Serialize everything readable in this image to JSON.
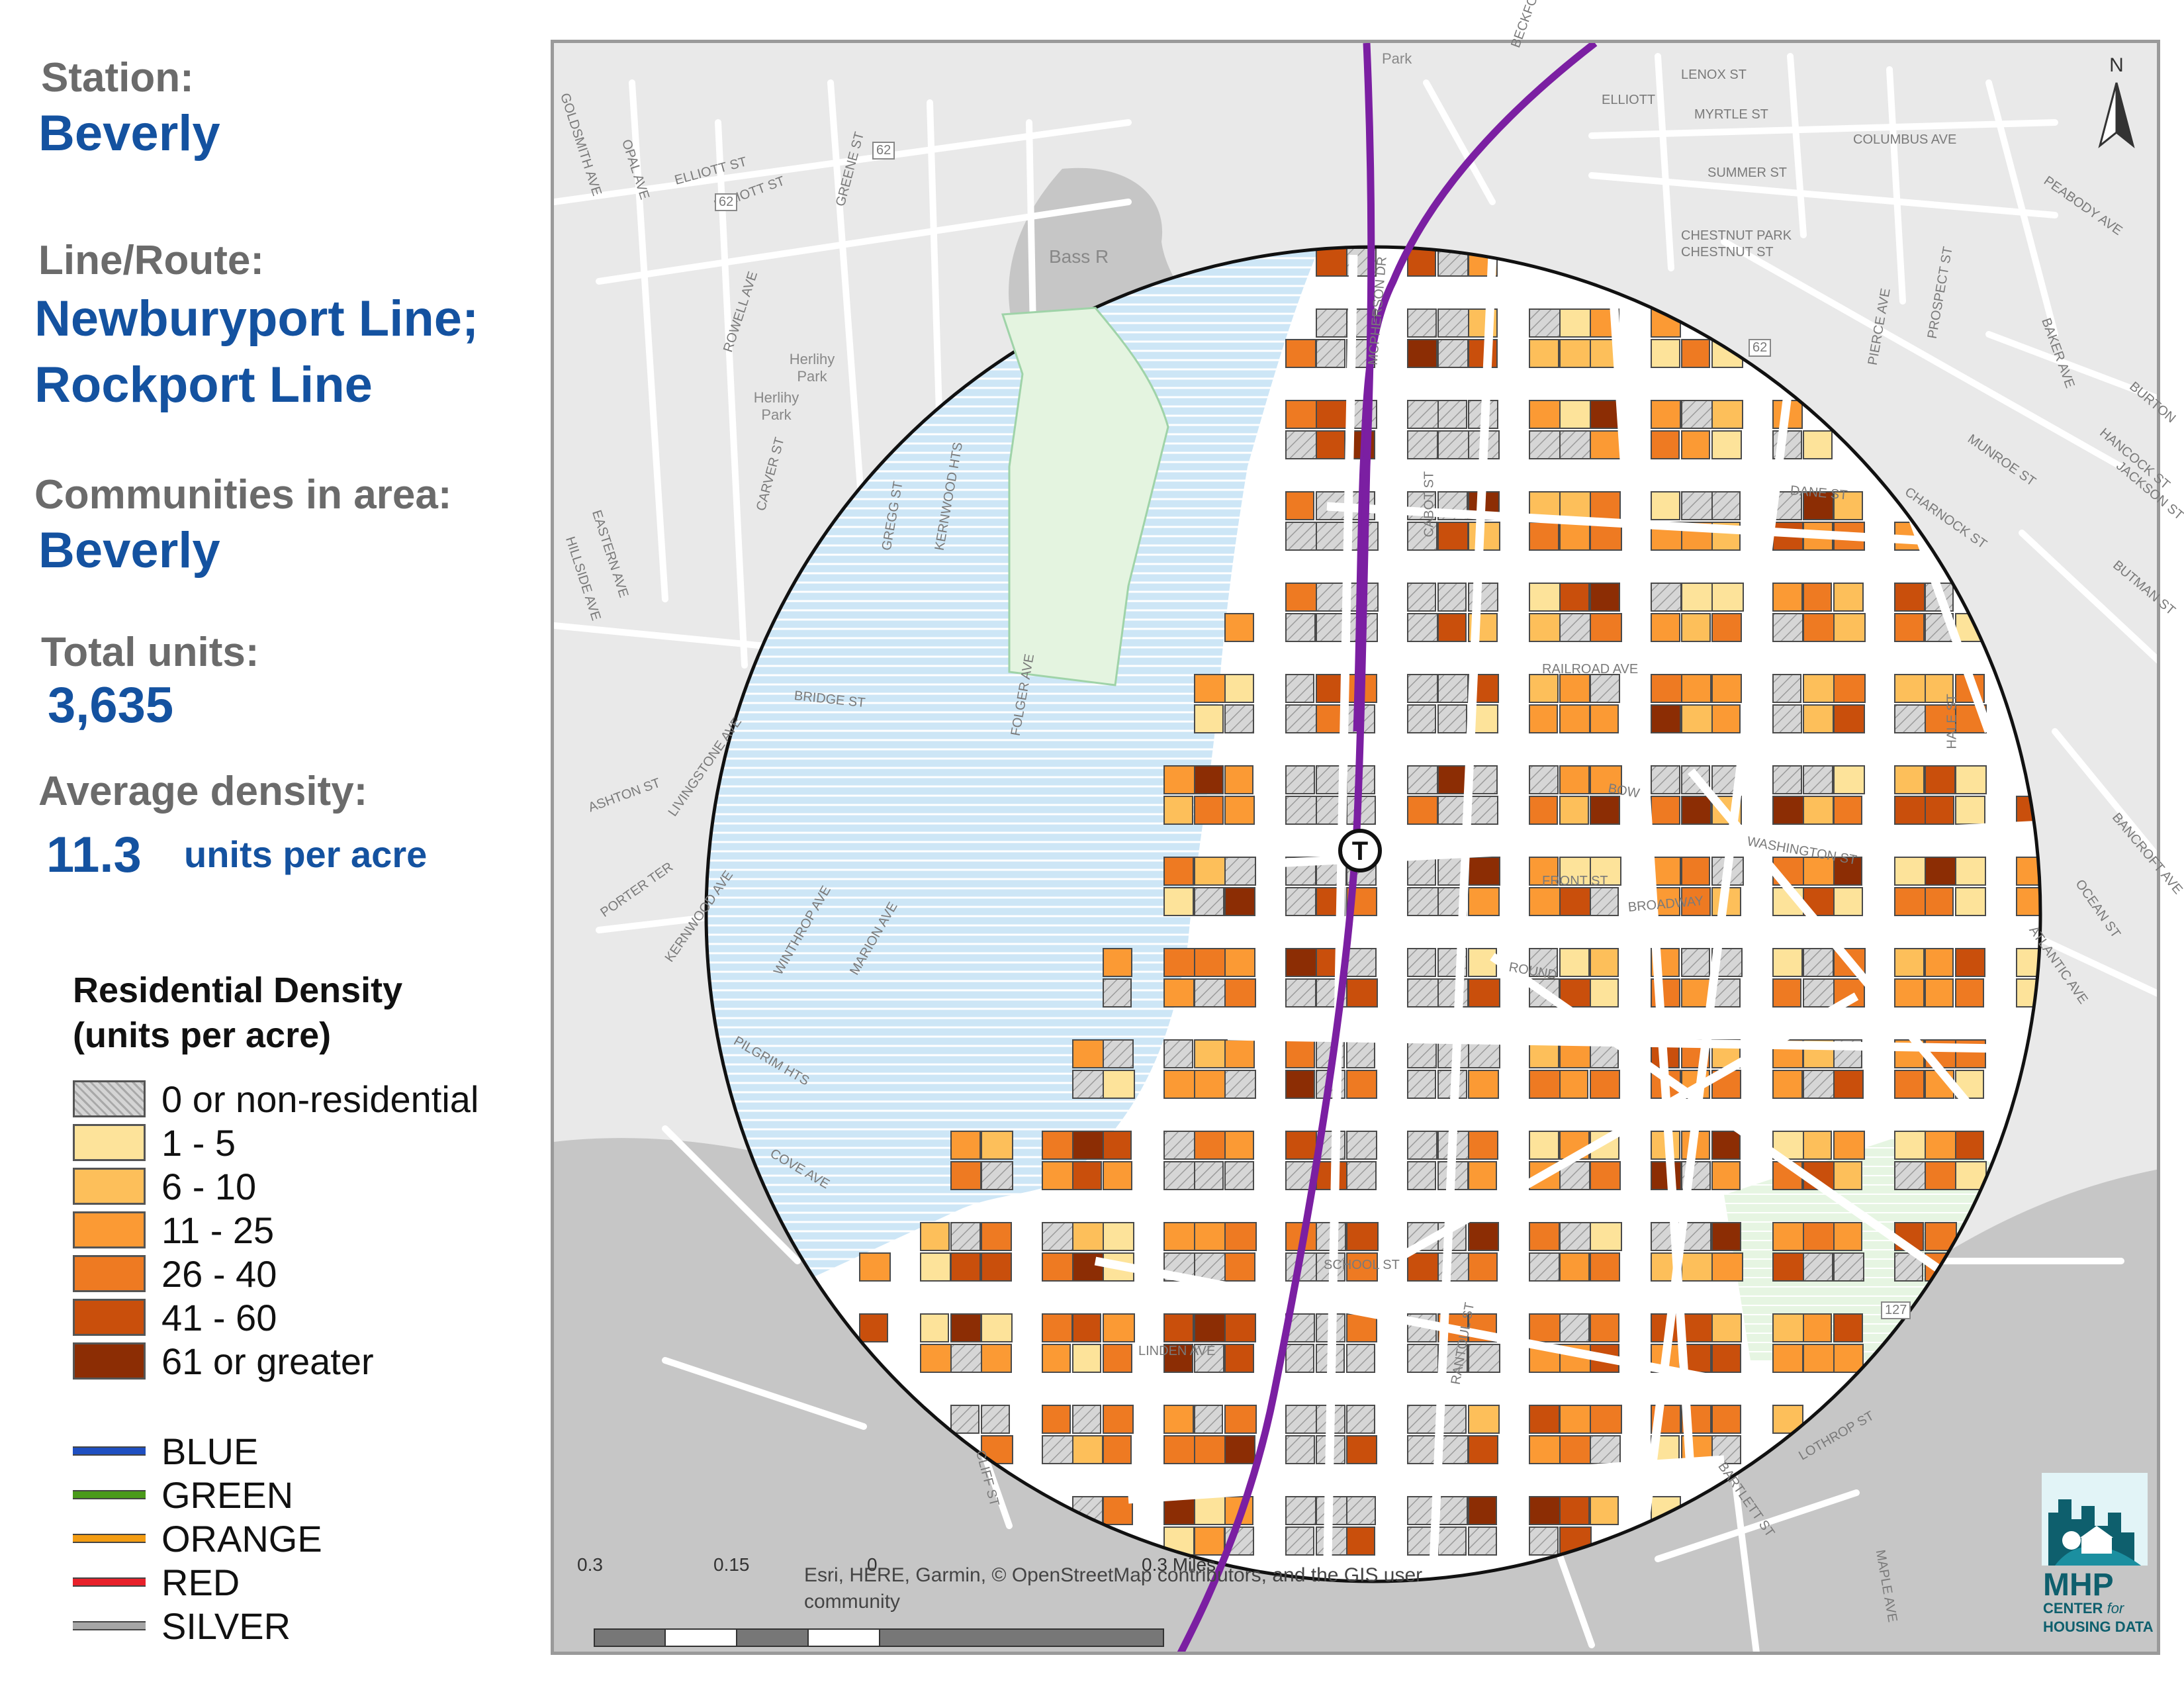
{
  "info": {
    "station_label": "Station:",
    "station_value": "Beverly",
    "line_label": "Line/Route:",
    "line_value_1": "Newburyport Line;",
    "line_value_2": "Rockport Line",
    "communities_label": "Communities in area:",
    "communities_value": "Beverly",
    "total_units_label": "Total units:",
    "total_units_value": "3,635",
    "avg_density_label": "Average density:",
    "avg_density_value": "11.3",
    "avg_density_unit": "units per acre"
  },
  "legend": {
    "title_1": "Residential Density",
    "title_2": "(units per acre)",
    "density_classes": [
      {
        "label": "0 or non-residential",
        "color": "#d4d4d4",
        "hatched": true
      },
      {
        "label": "1 - 5",
        "color": "#fde39a"
      },
      {
        "label": "6 - 10",
        "color": "#fdbf5a"
      },
      {
        "label": "11 - 25",
        "color": "#fb9a34"
      },
      {
        "label": "26 - 40",
        "color": "#ee7a22"
      },
      {
        "label": "41 - 60",
        "color": "#c94f0c"
      },
      {
        "label": "61 or greater",
        "color": "#8c2d04"
      }
    ],
    "lines": [
      {
        "label": "BLUE",
        "color": "#1f4fc1"
      },
      {
        "label": "GREEN",
        "color": "#4a9a1a"
      },
      {
        "label": "ORANGE",
        "color": "#f39c12"
      },
      {
        "label": "RED",
        "color": "#e8212b"
      },
      {
        "label": "SILVER",
        "color": "#a6a6a6"
      }
    ]
  },
  "map": {
    "station_symbol": "T",
    "commuter_rail_color": "#7b1fa2",
    "water_color": "#cfe8f7",
    "park_color": "#e4f4e0",
    "place_labels": [
      "Bass R",
      "Park",
      "Herlihy Park",
      "Herlihy Park"
    ],
    "streets": [
      "GOLDSMITH AVE",
      "OPAL AVE",
      "ELLIOTT ST",
      "GREENE ST",
      "ROWELL AVE",
      "CARVER ST",
      "EASTERN AVE",
      "HILLSIDE AVE",
      "GREGG ST",
      "KERNWOOD HTS",
      "BRIDGE ST",
      "ELLIOTT ST",
      "ASHTON ST",
      "LIVINGSTONE AVE",
      "FOLGER AVE",
      "PORTER TER",
      "KERNWOOD AVE",
      "WINTHROP AVE",
      "MARION AVE",
      "PILGRIM HTS",
      "COVE AVE",
      "CLIFF ST",
      "MCPHERSON DR",
      "BECKFORD ST",
      "LENOX ST",
      "MYRTLE ST",
      "COLUMBUS AVE",
      "SUMMER ST",
      "CHESTNUT PARK",
      "CHESTNUT ST",
      "PEABODY AVE",
      "PIERCE AVE",
      "PROSPECT ST",
      "BAKER AVE",
      "MUNROE ST",
      "CHARNOCK ST",
      "BURTON",
      "HANCOCK ST",
      "JACKSON ST",
      "BUTMAN ST",
      "BANCROFT AVE",
      "OCEAN ST",
      "ATLANTIC AVE",
      "BROADWAY",
      "SCHOOL ST",
      "LINDEN AVE",
      "RANTOUL ST",
      "BARTLETT ST",
      "LOTHROP ST",
      "MAPLE AVE",
      "DANE ST",
      "RAILROAD AVE",
      "CABOT ST",
      "HALE ST",
      "WASHINGTON ST",
      "FRONT ST",
      "ELLIOTT",
      "BOW",
      "ROUND"
    ],
    "route_shields": [
      "62",
      "62",
      "62",
      "127"
    ],
    "attribution": "Esri, HERE, Garmin, © OpenStreetMap contributors, and the GIS user community",
    "scale": {
      "labels": [
        "0.3",
        "0.15",
        "0",
        "0.3 Miles"
      ]
    },
    "north_label": "N",
    "logo": {
      "line1": "MHP",
      "line2": "CENTER",
      "line3": "for",
      "line4": "HOUSING DATA"
    }
  }
}
